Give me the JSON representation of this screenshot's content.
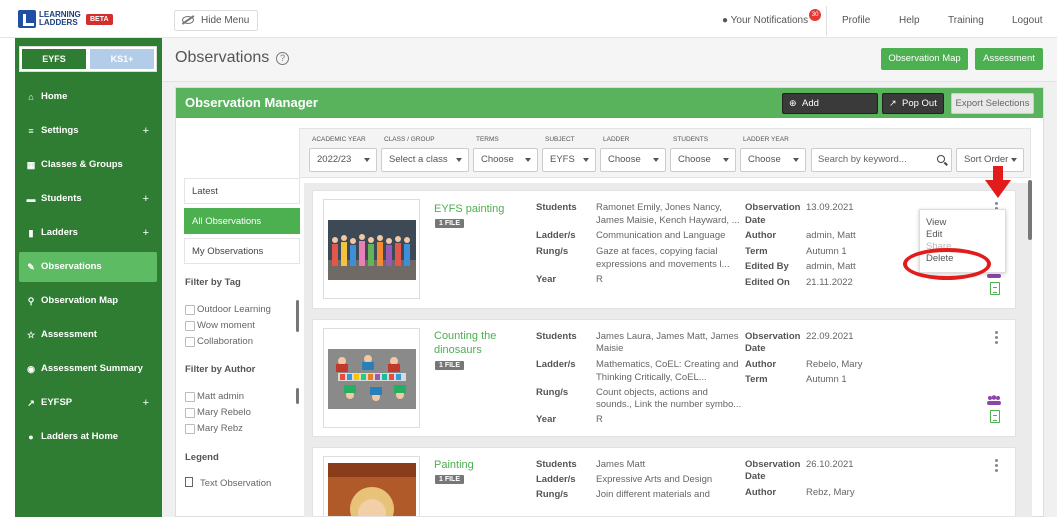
{
  "brand": {
    "logo_text": "LEARNING LADDERS",
    "beta": "BETA"
  },
  "topbar": {
    "hide_menu": "Hide Menu",
    "notifications": "Your Notifications",
    "notification_count": "30",
    "links": [
      "Profile",
      "Help",
      "Training",
      "Logout"
    ]
  },
  "sidebar": {
    "levels": [
      "EYFS",
      "KS1+"
    ],
    "items": [
      {
        "label": "Home",
        "icon": "home-icon",
        "plus": ""
      },
      {
        "label": "Settings",
        "icon": "bank-icon",
        "plus": "+"
      },
      {
        "label": "Classes & Groups",
        "icon": "grid-icon",
        "plus": ""
      },
      {
        "label": "Students",
        "icon": "students-icon",
        "plus": "+"
      },
      {
        "label": "Ladders",
        "icon": "book-icon",
        "plus": "+"
      },
      {
        "label": "Observations",
        "icon": "pencil-icon",
        "plus": ""
      },
      {
        "label": "Observation Map",
        "icon": "map-pin-icon",
        "plus": ""
      },
      {
        "label": "Assessment",
        "icon": "star-icon",
        "plus": ""
      },
      {
        "label": "Assessment Summary",
        "icon": "eye-icon",
        "plus": ""
      },
      {
        "label": "EYFSP",
        "icon": "line-chart-icon",
        "plus": "+"
      },
      {
        "label": "Ladders at Home",
        "icon": "users-icon",
        "plus": ""
      }
    ]
  },
  "header": {
    "title": "Observations",
    "help": "?",
    "buttons": [
      "Observation Map",
      "Assessment"
    ]
  },
  "manager": {
    "title": "Observation Manager",
    "add": "Add Observation",
    "popout": "Pop Out",
    "export": "Export Selections"
  },
  "filters": {
    "labels": [
      "ACADEMIC YEAR",
      "CLASS / GROUP",
      "TERMS",
      "SUBJECT",
      "LADDER",
      "STUDENTS",
      "LADDER YEAR"
    ],
    "values": [
      "2022/23",
      "Select a class",
      "Choose",
      "EYFS",
      "Choose",
      "Choose",
      "Choose"
    ],
    "search_placeholder": "Search by keyword...",
    "sort": "Sort Order"
  },
  "left_panel": {
    "tabs": [
      "Latest",
      "All Observations",
      "My Observations"
    ],
    "filter_by_tag": "Filter by Tag",
    "tags": [
      "Outdoor Learning",
      "Wow moment",
      "Collaboration"
    ],
    "filter_by_author": "Filter by Author",
    "authors": [
      "Matt admin",
      "Mary Rebelo",
      "Mary Rebz"
    ],
    "legend_title": "Legend",
    "legend_items": [
      "Text Observation"
    ]
  },
  "labels": {
    "students": "Students",
    "ladders": "Ladder/s",
    "rungs": "Rung/s",
    "year": "Year",
    "obs_date_1": "Observation",
    "obs_date_2": "Date",
    "author": "Author",
    "term": "Term",
    "edited_by": "Edited By",
    "edited_on": "Edited On"
  },
  "observations": [
    {
      "title_1": "EYFS painting",
      "title_2": "",
      "files": "1 FILE",
      "students_1": "Ramonet Emily, Jones Nancy,",
      "students_2": "James Maisie, Kench Hayward, ...",
      "ladders": "Communication and Language",
      "rungs_1": "Gaze at faces, copying facial",
      "rungs_2": "expressions and movements l...",
      "year": "R",
      "date": "13.09.2021",
      "author": "admin, Matt",
      "term": "Autumn 1",
      "edited_by": "admin, Matt",
      "edited_on": "21.11.2022"
    },
    {
      "title_1": "Counting the",
      "title_2": "dinosaurs",
      "files": "1 FILE",
      "students_1": "James Laura, James Matt, James",
      "students_2": "Maisie",
      "ladders_1": "Mathematics, CoEL: Creating and",
      "ladders_2": "Thinking Critically, CoEL...",
      "rungs_1": "Count objects, actions and",
      "rungs_2": "sounds., Link the number symbo...",
      "year": "R",
      "date": "22.09.2021",
      "author": "Rebelo, Mary",
      "term": "Autumn 1"
    },
    {
      "title_1": "Painting",
      "title_2": "",
      "files": "1 FILE",
      "students_1": "James Matt",
      "ladders": "Expressive Arts and Design",
      "rungs_1": "Join different materials and",
      "date": "26.10.2021",
      "author": "Rebz, Mary"
    }
  ],
  "dropdown": [
    "View",
    "Edit",
    "Share",
    "Delete"
  ],
  "colors": {
    "sidebar": "#2e7d32",
    "accent": "#4caf50",
    "highlight": "#e21b1b"
  }
}
